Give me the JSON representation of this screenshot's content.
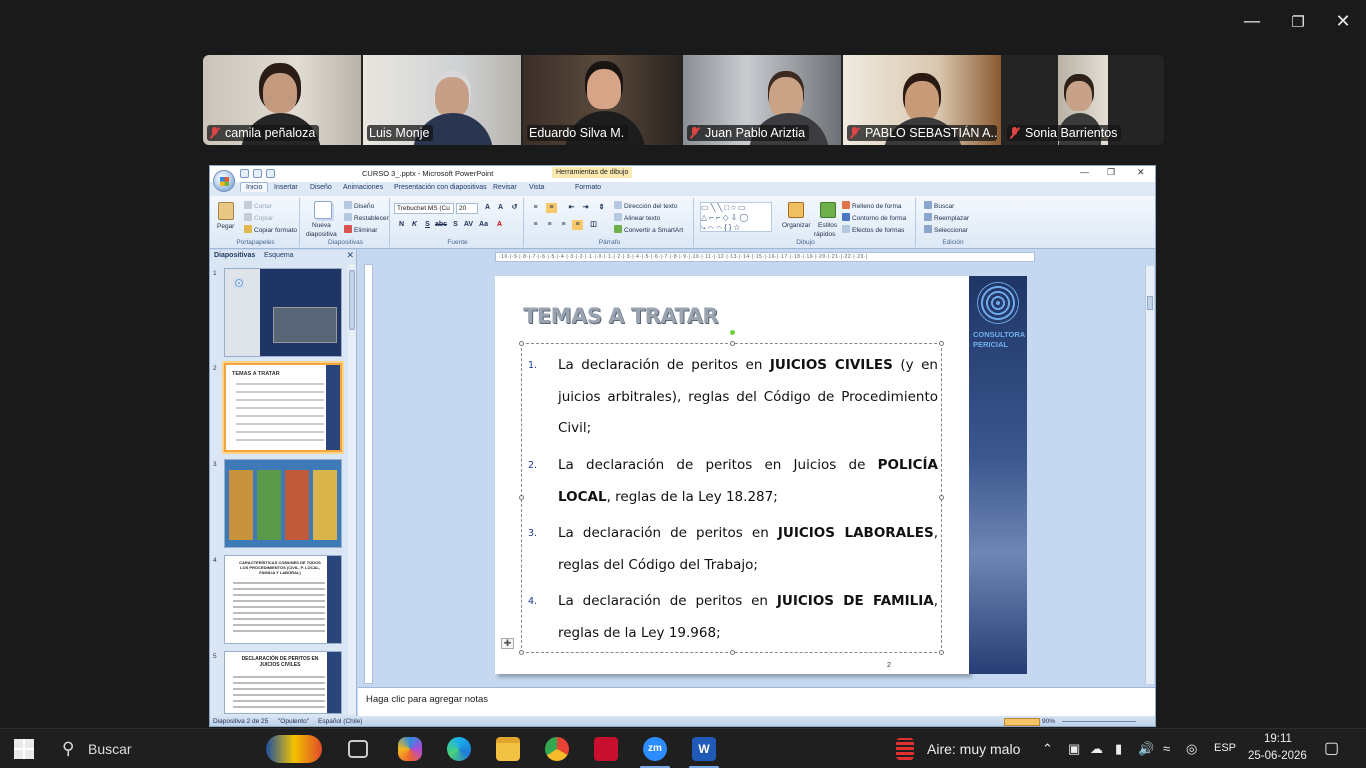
{
  "participants": [
    {
      "name": "camila peñaloza",
      "muted": true
    },
    {
      "name": "Luis Monje",
      "muted": false
    },
    {
      "name": "Eduardo Silva M.",
      "muted": false,
      "active": true
    },
    {
      "name": "Juan Pablo Ariztia",
      "muted": true
    },
    {
      "name": "PABLO SEBASTIÁN A...",
      "muted": true
    },
    {
      "name": "Sonia Barrientos",
      "muted": true
    }
  ],
  "ppt": {
    "title": "CURSO 3_.pptx - Microsoft PowerPoint",
    "context_tab": "Herramientas de dibujo",
    "tabs": [
      "Inicio",
      "Insertar",
      "Diseño",
      "Animaciones",
      "Presentación con diapositivas",
      "Revisar",
      "Vista",
      "Formato"
    ],
    "ribbon": {
      "portapapeles": {
        "pegar": "Pegar",
        "cortar": "Cortar",
        "copiar": "Copiar",
        "copiar_formato": "Copiar formato",
        "label": "Portapapeles"
      },
      "diapositivas": {
        "nueva": "Nueva",
        "diapositiva": "diapositiva",
        "diseno": "Diseño",
        "restablecer": "Restablecer",
        "eliminar": "Eliminar",
        "label": "Diapositivas"
      },
      "fuente": {
        "font": "Trebuchet MS (Cu",
        "size": "20",
        "label": "Fuente"
      },
      "parrafo": {
        "direccion": "Dirección del texto",
        "alinear": "Alinear texto",
        "smartart": "Convertir a SmartArt",
        "label": "Párrafo"
      },
      "dibujo": {
        "organizar": "Organizar",
        "estilos": "Estilos",
        "rapidos": "rápidos",
        "relleno": "Relleno de forma",
        "contorno": "Contorno de forma",
        "efectos": "Efectos de formas",
        "label": "Dibujo"
      },
      "edicion": {
        "buscar": "Buscar",
        "reemplazar": "Reemplazar",
        "seleccionar": "Seleccionar",
        "label": "Edición"
      }
    },
    "panel_tabs": {
      "slides": "Diapositivas",
      "outline": "Esquema"
    },
    "thumb_numbers": [
      "1",
      "2",
      "3",
      "4",
      "5"
    ],
    "thumbs": {
      "t2_title": "TEMAS A TRATAR",
      "t4_title": "CARACTERÍSTICAS COMUNES DE TODOS LOS PROCEDIMIENTOS (CIVIL, P. LOCAL, FAMILIA Y LABORAL)",
      "t5_title": "DECLARACIÓN DE PERITOS EN JUICIOS CIVILES"
    },
    "ruler_text": "·10·|·9·|·8·|·7·|·6·|·5·|·4·|·3·|·2·|·1·|·0·|·1·|·2·|·3·|·4·|·5·|·6·|·7·|·8·|·9·|·10·|·11·|·12·|·13·|·14·|·15·|·16·|·17·|·18·|·19·|·20·|·21·|·22·|·23·|",
    "slide": {
      "title": "TEMAS A TRATAR",
      "logo_text": "CONSULTORA PERICIAL",
      "page_number": "2",
      "items": [
        {
          "num": "1.",
          "pre": "La declaración de peritos en ",
          "bold": "JUICIOS CIVILES",
          "post": " (y en juicios arbitrales), reglas del Código de Procedimiento Civil;"
        },
        {
          "num": "2.",
          "pre": "La declaración de peritos en Juicios de ",
          "bold": "POLICÍA LOCAL",
          "post": ", reglas de la Ley 18.287;"
        },
        {
          "num": "3.",
          "pre": "La declaración de peritos en ",
          "bold": "JUICIOS LABORALES",
          "post": ", reglas del Código del Trabajo;"
        },
        {
          "num": "4.",
          "pre": "La declaración de peritos en ",
          "bold": "JUICIOS DE FAMILIA",
          "post": ", reglas de la Ley 19.968;"
        }
      ]
    },
    "notes_placeholder": "Haga clic para agregar notas",
    "status": {
      "slide": "Diapositiva 2 de 25",
      "theme": "\"Opulento\"",
      "language": "Español (Chile)",
      "zoom": "90%"
    }
  },
  "taskbar": {
    "search": "Buscar",
    "weather": "Aire: muy malo",
    "lang": "ESP",
    "time": "19:11",
    "date": "25-06-2026"
  }
}
